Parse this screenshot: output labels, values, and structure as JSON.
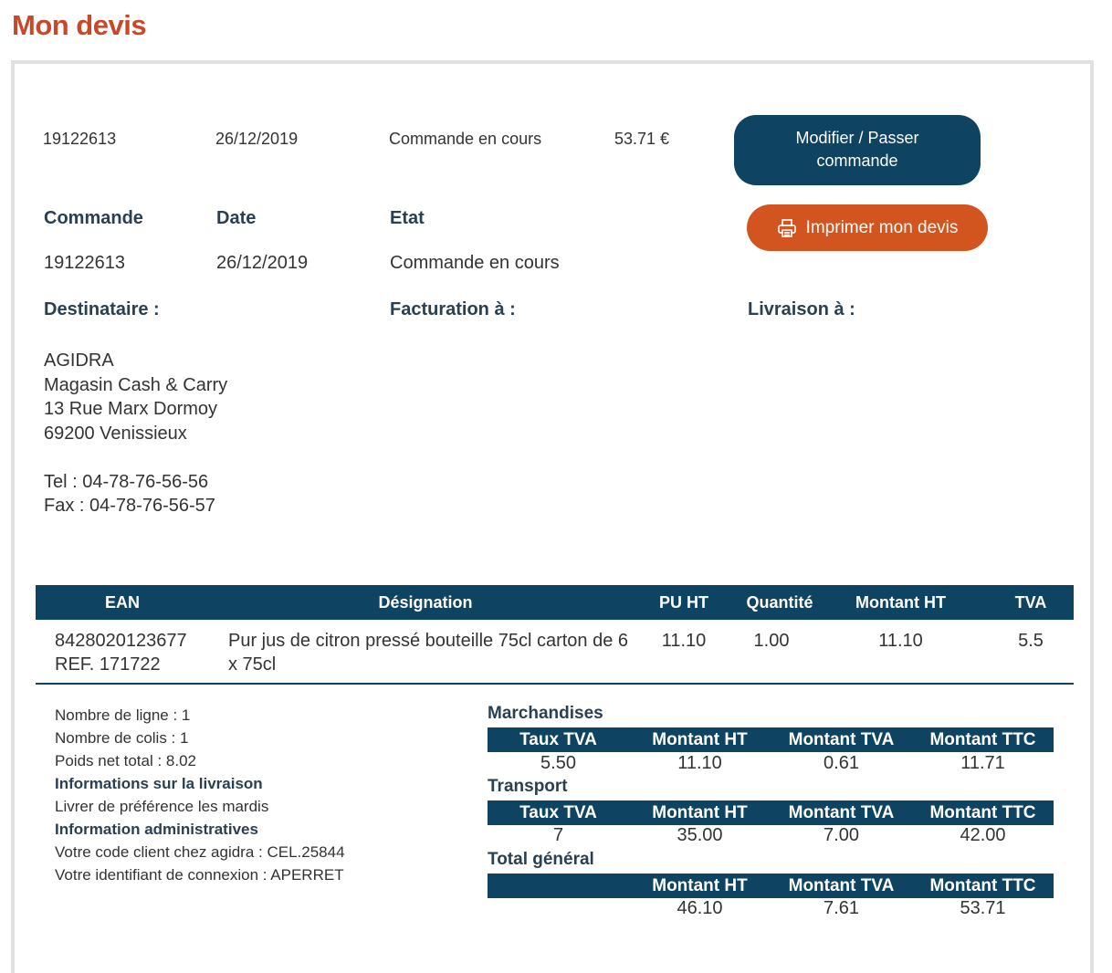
{
  "page": {
    "title": "Mon devis"
  },
  "summary": {
    "number": "19122613",
    "date": "26/12/2019",
    "status": "Commande en cours",
    "amount": "53.71 €"
  },
  "buttons": {
    "modify_line1": "Modifier / Passer",
    "modify_line2": "commande",
    "print": "Imprimer mon devis"
  },
  "order": {
    "headers": {
      "commande": "Commande",
      "date": "Date",
      "etat": "Etat"
    },
    "values": {
      "commande": "19122613",
      "date": "26/12/2019",
      "etat": "Commande en cours"
    }
  },
  "parties": {
    "destinataire": "Destinataire :",
    "facturation": "Facturation à :",
    "livraison": "Livraison à :"
  },
  "address": {
    "name": "AGIDRA",
    "line1": "Magasin Cash & Carry",
    "line2": "13 Rue Marx Dormoy",
    "line3": "69200 Venissieux",
    "tel": "Tel : 04-78-76-56-56",
    "fax": "Fax : 04-78-76-56-57"
  },
  "table": {
    "headers": {
      "ean": "EAN",
      "designation": "Désignation",
      "pu": "PU HT",
      "qty": "Quantité",
      "montant": "Montant HT",
      "tva": "TVA"
    },
    "rows": [
      {
        "ean": "8428020123677",
        "ref": "REF. 171722",
        "designation_1": "Pur jus de citron pressé bouteille 75cl carton de 6",
        "designation_2": "x 75cl",
        "pu": "11.10",
        "qty": "1.00",
        "montant": "11.10",
        "tva": "5.5"
      }
    ]
  },
  "info": {
    "lines": "Nombre de ligne : 1",
    "colis": "Nombre de colis : 1",
    "poids": "Poids net total : 8.02",
    "livraison_title": "Informations sur la livraison",
    "livraison_text": "Livrer de préférence les mardis",
    "admin_title": "Information administratives",
    "client_code": "Votre code client chez agidra : CEL.25844",
    "login": "Votre identifiant de connexion : APERRET"
  },
  "totals": {
    "headers": {
      "taux": "Taux TVA",
      "ht": "Montant HT",
      "tva": "Montant TVA",
      "ttc": "Montant TTC"
    },
    "marchandises": {
      "title": "Marchandises",
      "taux": "5.50",
      "ht": "11.10",
      "tva": "0.61",
      "ttc": "11.71"
    },
    "transport": {
      "title": "Transport",
      "taux": "7",
      "ht": "35.00",
      "tva": "7.00",
      "ttc": "42.00"
    },
    "general": {
      "title": "Total général",
      "ht": "46.10",
      "tva": "7.61",
      "ttc": "53.71"
    }
  },
  "colors": {
    "primary": "#0e4361",
    "accent": "#d2541f",
    "title": "#c8492a"
  },
  "icons": {
    "print": "printer-icon"
  }
}
